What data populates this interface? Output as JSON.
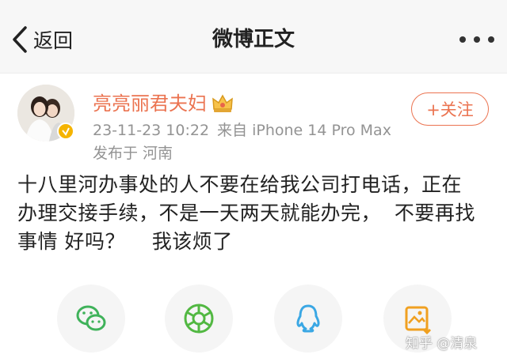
{
  "nav": {
    "back_label": "返回",
    "title": "微博正文"
  },
  "user": {
    "name": "亮亮丽君夫妇",
    "timestamp": "23-11-23 10:22",
    "source": "来自 iPhone 14 Pro Max",
    "location_prefix": "发布于",
    "location": "河南",
    "follow_label": "+关注"
  },
  "post": {
    "lines": [
      "十八里河办事处的人不要在给我公司打电话，正在",
      "办理交接手续，不是一天两天就能办完，  不要再找",
      "事情 好吗？    我该烦了"
    ]
  },
  "share": {
    "icons": [
      "wechat-icon",
      "moments-icon",
      "qq-icon",
      "save-image-icon"
    ]
  },
  "watermark": "知乎 @清泉",
  "colors": {
    "accent": "#eb7350",
    "meta": "#939393",
    "wechat": "#3fb25a",
    "moments": "#52b842",
    "qq": "#3aa7e4",
    "save": "#f0a020"
  }
}
